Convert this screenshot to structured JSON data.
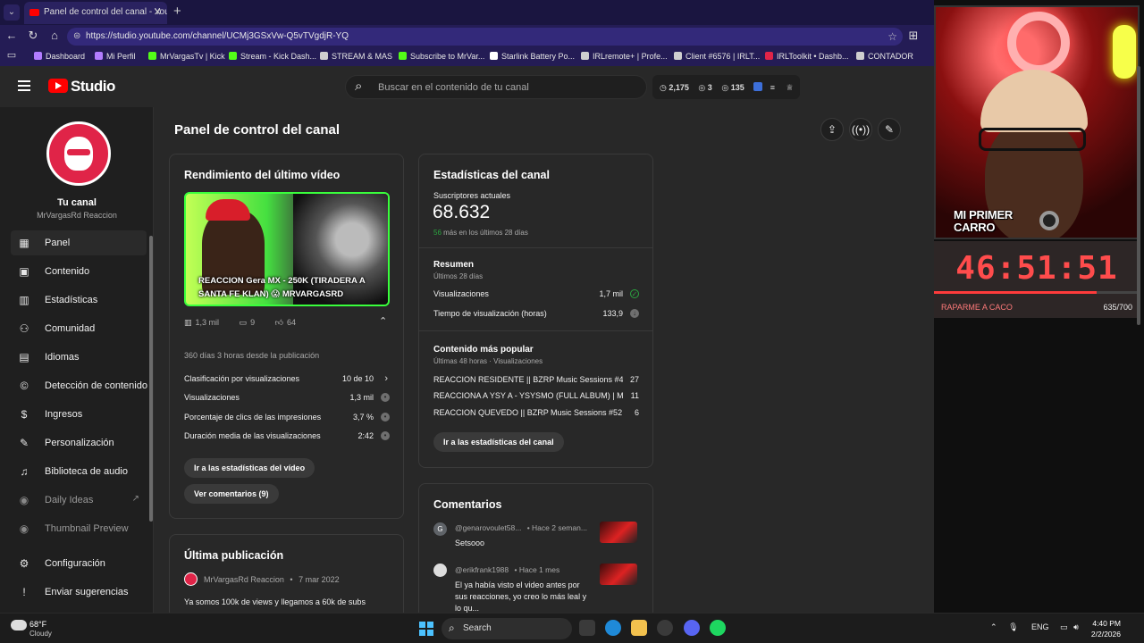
{
  "browser": {
    "tab_title": "Panel de control del canal - YouTube",
    "url": "https://studio.youtube.com/channel/UCMj3GSxVw-Q5vTVgdjR-YQ",
    "bookmarks": [
      {
        "label": "Dashboard",
        "color": "#b27cff"
      },
      {
        "label": "Mi Perfil",
        "color": "#b27cff"
      },
      {
        "label": "MrVargasTv | Kick",
        "color": "#53fc18"
      },
      {
        "label": "Stream - Kick Dash...",
        "color": "#53fc18"
      },
      {
        "label": "STREAM & MAS",
        "color": "#cfcfcf"
      },
      {
        "label": "Subscribe to MrVar...",
        "color": "#53fc18"
      },
      {
        "label": "Starlink Battery Po...",
        "color": "#ffffff"
      },
      {
        "label": "IRLremote+ | Profe...",
        "color": "#cfcfcf"
      },
      {
        "label": "Client #6576 | IRLT...",
        "color": "#cfcfcf"
      },
      {
        "label": "IRLToolkit • Dashb...",
        "color": "#e02448"
      },
      {
        "label": "CONTADOR",
        "color": "#cfcfcf"
      }
    ]
  },
  "header": {
    "logo_text": "Studio",
    "search_placeholder": "Buscar en el contenido de tu canal",
    "counters": [
      "2,175",
      "3",
      "135"
    ]
  },
  "sidebar": {
    "channel_title": "Tu canal",
    "channel_name": "MrVargasRd Reaccion",
    "items": [
      {
        "label": "Panel",
        "icon": "dashboard-icon"
      },
      {
        "label": "Contenido",
        "icon": "content-icon"
      },
      {
        "label": "Estadísticas",
        "icon": "analytics-icon"
      },
      {
        "label": "Comunidad",
        "icon": "community-icon"
      },
      {
        "label": "Idiomas",
        "icon": "subtitles-icon"
      },
      {
        "label": "Detección de contenido",
        "icon": "copyright-icon"
      },
      {
        "label": "Ingresos",
        "icon": "earn-icon"
      },
      {
        "label": "Personalización",
        "icon": "customization-icon"
      },
      {
        "label": "Biblioteca de audio",
        "icon": "audio-library-icon"
      },
      {
        "label": "Daily Ideas",
        "icon": "extension-icon"
      },
      {
        "label": "Thumbnail Preview",
        "icon": "extension-icon"
      },
      {
        "label": "Configuración",
        "icon": "settings-icon"
      },
      {
        "label": "Enviar sugerencias",
        "icon": "feedback-icon"
      }
    ]
  },
  "main": {
    "page_title": "Panel de control del canal",
    "latest_video": {
      "card_title": "Rendimiento del último vídeo",
      "thumb_title": "REACCION Gera MX - 250K (TIRADERA A SANTA FE KLAN) 😱 MRVARGASRD",
      "views_short": "1,3 mil",
      "comments": "9",
      "likes": "64",
      "since_publish": "360 días 3 horas desde la publicación",
      "rows": [
        {
          "label": "Clasificación por visualizaciones",
          "value": "10 de 10"
        },
        {
          "label": "Visualizaciones",
          "value": "1,3 mil"
        },
        {
          "label": "Porcentaje de clics de las impresiones",
          "value": "3,7 %"
        },
        {
          "label": "Duración media de las visualizaciones",
          "value": "2:42"
        }
      ],
      "btn_analytics": "Ir a las estadísticas del vídeo",
      "btn_comments": "Ver comentarios (9)"
    },
    "last_post": {
      "card_title": "Última publicación",
      "author": "MrVargasRd Reaccion",
      "date": "7 mar 2022",
      "text": "Ya somos 100k de views y llegamos a 60k de subs"
    },
    "channel_stats": {
      "card_title": "Estadísticas del canal",
      "subs_label": "Suscriptores actuales",
      "subs_value": "68.632",
      "subs_delta": "56",
      "subs_delta_text": "más en los últimos 28 días",
      "summary_title": "Resumen",
      "summary_period": "Últimos 28 días",
      "summary_rows": [
        {
          "label": "Visualizaciones",
          "value": "1,7 mil"
        },
        {
          "label": "Tiempo de visualización (horas)",
          "value": "133,9"
        }
      ],
      "top_title": "Contenido más popular",
      "top_period": "Últimas 48 horas · Visualizaciones",
      "top_rows": [
        {
          "label": "REACCION RESIDENTE || BZRP Music Sessions #49 | ...",
          "value": "27"
        },
        {
          "label": "REACCIONA A YSY A - YSYSMO (FULL ALBUM) | MrVa...",
          "value": "11"
        },
        {
          "label": "REACCION QUEVEDO || BZRP Music Sessions #52 | M...",
          "value": "6"
        }
      ],
      "btn": "Ir a las estadísticas del canal"
    },
    "comments": {
      "card_title": "Comentarios",
      "items": [
        {
          "avatar": "G",
          "user": "@genarovoulet58...",
          "time": "• Hace 2 seman...",
          "text": "Setsooo"
        },
        {
          "avatar": "",
          "user": "@erikfrank1988",
          "time": "• Hace 1 mes",
          "text": "El ya había visto el video antes por sus reacciones, yo creo lo más leal y lo qu..."
        }
      ]
    }
  },
  "overlay": {
    "cam_caption_line1": "MI PRIMER",
    "cam_caption_line2": "CARRO",
    "timer": "46:51:51",
    "timer_label": "RAPARME A CACO",
    "timer_count": "635/700",
    "timer_progress": 0.79
  },
  "taskbar": {
    "temp": "68°F",
    "weather": "Cloudy",
    "search": "Search",
    "lang": "ENG",
    "time": "4:40 PM",
    "date": "2/2/2026"
  }
}
